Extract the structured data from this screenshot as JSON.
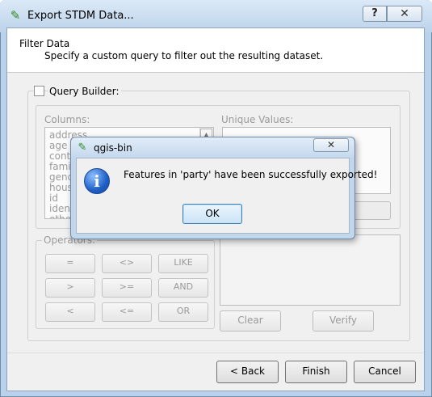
{
  "window": {
    "title": "Export STDM Data...",
    "help_glyph": "?",
    "close_glyph": "✕"
  },
  "header": {
    "title": "Filter Data",
    "subtitle": "Specify a custom query to filter out the resulting dataset."
  },
  "query_builder": {
    "label": "Query Builder:",
    "checked": false,
    "columns_label": "Columns:",
    "unique_values_label": "Unique Values:",
    "columns": [
      "address",
      "age",
      "conta",
      "family",
      "gende",
      "house",
      "id",
      "identi",
      "other"
    ],
    "operators_label": "Operators:",
    "operators": [
      "=",
      "<>",
      "LIKE",
      ">",
      ">=",
      "AND",
      "<",
      "<=",
      "OR"
    ],
    "clear_label": "Clear",
    "verify_label": "Verify"
  },
  "nav": {
    "back_label": "< Back",
    "finish_label": "Finish",
    "cancel_label": "Cancel"
  },
  "message_box": {
    "title": "qgis-bin",
    "message": "Features in 'party' have been successfully exported!",
    "ok_label": "OK",
    "close_glyph": "✕",
    "icon": "info-icon"
  },
  "colors": {
    "titlebar": "#bcd3ea",
    "dialog_bg": "#f0f0f0",
    "info_blue": "#1e5fc7",
    "disabled_text": "#9a9a9a"
  }
}
